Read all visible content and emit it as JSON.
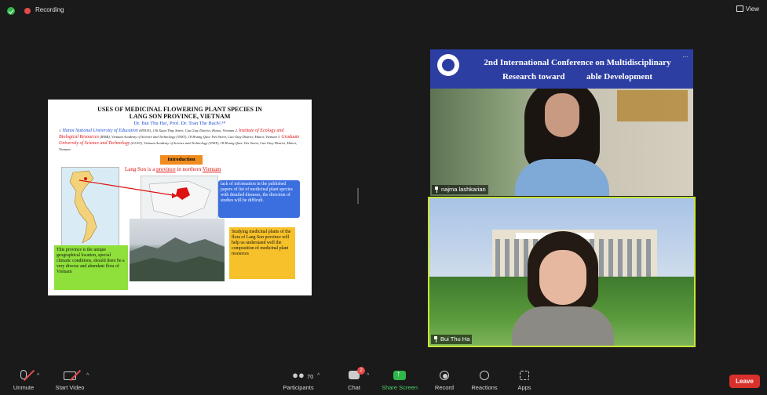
{
  "topbar": {
    "recording_label": "Recording",
    "view_label": "View"
  },
  "slide": {
    "title_line1": "USES OF MEDICINAL FLOWERING PLANT SPECIES IN",
    "title_line2": "LANG SON PROVINCE, VIETNAM",
    "authors": "Dr. Bui Thu Ha¹, Prof. Dr. Tran The Bach²,³*",
    "aff_num": "1.",
    "aff_org1": "Hanoi National University of Education",
    "aff_text1": "(HNUE), 136 Xuan Thuy Street, Cau Giay District, Hanoi, Vietnam 2.",
    "aff_org2": "Institute of Ecology and Biological Resources",
    "aff_text2": "(IEBR), Vietnam Academy of Science and Technology (VAST), 18 Hoang Quoc Viet Street, Cau Giay District, Hanoi, Vietnam 3.",
    "aff_org3": "Graduate University of Science and Technology",
    "aff_text3": "(GUST), Vietnam Academy of Science and Technology (VAST), 18 Hoang Quoc Viet Street, Cau Giay District, Hanoi, Vietnam",
    "intro_label": "Introduction",
    "langson_a": "Lang Son is a ",
    "langson_b": "province",
    "langson_c": " in northern ",
    "langson_d": "Vietnam",
    "blue_box": "lack of information in the published papers of list of medicinal plant species with detailed diseases, the direction of studies will be difficult.",
    "green_box": "This province is the unique geographical location, special climatic conditions, should there be a very diverse and abundant flora of Vietnam",
    "yellow_box": "Studying medicinal plants of the flora of Lang Son province will help us understand well the composition of medicinal plant resources"
  },
  "video_tile_1": {
    "banner_line1": "2nd International Conference on Multidisciplinary",
    "banner_line2": "Research toward",
    "banner_line2_end": "able Development",
    "more_label": "...",
    "participant_name": "najma lashkarian"
  },
  "video_tile_2": {
    "participant_name": "Bui Thu Ha"
  },
  "toolbar": {
    "unmute_label": "Unmute",
    "start_video_label": "Start Video",
    "participants_label": "Participants",
    "participants_count": "70",
    "chat_label": "Chat",
    "chat_badge": "2",
    "share_screen_label": "Share Screen",
    "record_label": "Record",
    "reactions_label": "Reactions",
    "apps_label": "Apps",
    "leave_label": "Leave",
    "caret": "^"
  },
  "colors": {
    "background": "#1a1a1a",
    "share_green": "#4ed36b",
    "leave_red": "#d9302c",
    "active_speaker_border": "#c7e635"
  }
}
